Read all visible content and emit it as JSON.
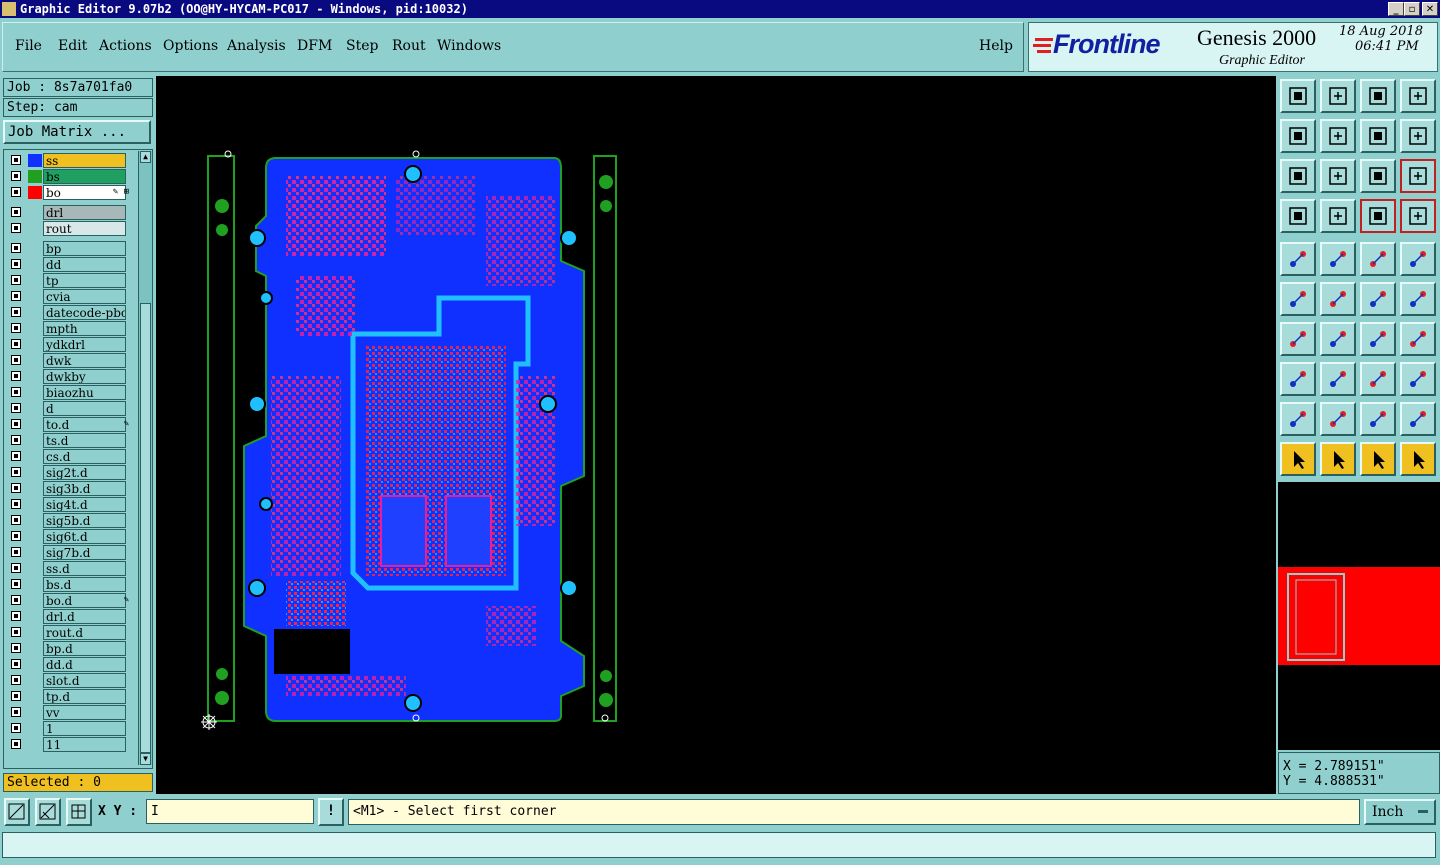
{
  "window": {
    "title": "Graphic Editor 9.07b2 (OO@HY-HYCAM-PC017 - Windows, pid:10032)"
  },
  "menu": [
    "File",
    "Edit",
    "Actions",
    "Options",
    "Analysis",
    "DFM",
    "Step",
    "Rout",
    "Windows"
  ],
  "help_label": "Help",
  "brand": {
    "logo": "Frontline",
    "product": "Genesis 2000",
    "subtitle": "Graphic Editor",
    "date": "18 Aug 2018",
    "time": "06:41 PM"
  },
  "job": {
    "job_label": "Job : 8s7a701fa0",
    "step_label": "Step: cam",
    "matrix_button": "Job Matrix ..."
  },
  "layers": [
    {
      "name": "ss",
      "bg": "#f0c020",
      "swatch": "#1030ff",
      "edit": ""
    },
    {
      "name": "bs",
      "bg": "#20a060",
      "swatch": "#20a020",
      "edit": ""
    },
    {
      "name": "bo",
      "bg": "#ffffff",
      "swatch": "#ff0000",
      "edit": "✎ ⊞",
      "active": true
    },
    {
      "name": "drl",
      "bg": "#a8b8b8",
      "swatch": "",
      "edit": "",
      "gap": true
    },
    {
      "name": "rout",
      "bg": "#d8e8e8",
      "swatch": "",
      "edit": ""
    },
    {
      "name": "bp",
      "bg": "#8fd0cf",
      "swatch": "",
      "edit": "",
      "gap": true
    },
    {
      "name": "dd",
      "bg": "#8fd0cf",
      "swatch": "",
      "edit": ""
    },
    {
      "name": "tp",
      "bg": "#8fd0cf",
      "swatch": "",
      "edit": ""
    },
    {
      "name": "cvia",
      "bg": "#8fd0cf",
      "swatch": "",
      "edit": ""
    },
    {
      "name": "datecode-pbc",
      "bg": "#8fd0cf",
      "swatch": "",
      "edit": ""
    },
    {
      "name": "mpth",
      "bg": "#8fd0cf",
      "swatch": "",
      "edit": ""
    },
    {
      "name": "ydkdrl",
      "bg": "#8fd0cf",
      "swatch": "",
      "edit": ""
    },
    {
      "name": "dwk",
      "bg": "#8fd0cf",
      "swatch": "",
      "edit": ""
    },
    {
      "name": "dwkby",
      "bg": "#8fd0cf",
      "swatch": "",
      "edit": ""
    },
    {
      "name": "biaozhu",
      "bg": "#8fd0cf",
      "swatch": "",
      "edit": ""
    },
    {
      "name": "d",
      "bg": "#8fd0cf",
      "swatch": "",
      "edit": ""
    },
    {
      "name": "to.d",
      "bg": "#8fd0cf",
      "swatch": "",
      "edit": "✎"
    },
    {
      "name": "ts.d",
      "bg": "#8fd0cf",
      "swatch": "",
      "edit": ""
    },
    {
      "name": "cs.d",
      "bg": "#8fd0cf",
      "swatch": "",
      "edit": ""
    },
    {
      "name": "sig2t.d",
      "bg": "#8fd0cf",
      "swatch": "",
      "edit": ""
    },
    {
      "name": "sig3b.d",
      "bg": "#8fd0cf",
      "swatch": "",
      "edit": ""
    },
    {
      "name": "sig4t.d",
      "bg": "#8fd0cf",
      "swatch": "",
      "edit": ""
    },
    {
      "name": "sig5b.d",
      "bg": "#8fd0cf",
      "swatch": "",
      "edit": ""
    },
    {
      "name": "sig6t.d",
      "bg": "#8fd0cf",
      "swatch": "",
      "edit": ""
    },
    {
      "name": "sig7b.d",
      "bg": "#8fd0cf",
      "swatch": "",
      "edit": ""
    },
    {
      "name": "ss.d",
      "bg": "#8fd0cf",
      "swatch": "",
      "edit": ""
    },
    {
      "name": "bs.d",
      "bg": "#8fd0cf",
      "swatch": "",
      "edit": ""
    },
    {
      "name": "bo.d",
      "bg": "#8fd0cf",
      "swatch": "",
      "edit": "✎"
    },
    {
      "name": "drl.d",
      "bg": "#8fd0cf",
      "swatch": "",
      "edit": ""
    },
    {
      "name": "rout.d",
      "bg": "#8fd0cf",
      "swatch": "",
      "edit": ""
    },
    {
      "name": "bp.d",
      "bg": "#8fd0cf",
      "swatch": "",
      "edit": ""
    },
    {
      "name": "dd.d",
      "bg": "#8fd0cf",
      "swatch": "",
      "edit": ""
    },
    {
      "name": "slot.d",
      "bg": "#8fd0cf",
      "swatch": "",
      "edit": ""
    },
    {
      "name": "tp.d",
      "bg": "#8fd0cf",
      "swatch": "",
      "edit": ""
    },
    {
      "name": "vv",
      "bg": "#8fd0cf",
      "swatch": "",
      "edit": ""
    },
    {
      "name": "1",
      "bg": "#8fd0cf",
      "swatch": "",
      "edit": ""
    },
    {
      "name": "11",
      "bg": "#8fd0cf",
      "swatch": "",
      "edit": ""
    }
  ],
  "selected_label": "Selected : 0",
  "tools": [
    "open-job-icon",
    "save-icon",
    "home-icon",
    "window-icon",
    "snap-in-icon",
    "snap-out-icon",
    "undo-icon",
    "redraw-icon",
    "zoom-fit-icon",
    "zoom-center-icon",
    "zoom-one-to-two-icon",
    "help-query-icon",
    "features-filter-icon",
    "single-layer-icon",
    "traffic-light-icon",
    "traffic-light-alt-icon",
    "feature-select-icon",
    "polygon-icon",
    "ruler-icon",
    "pad-icon",
    "net-select-icon",
    "cross-icon",
    "point-to-point-icon",
    "point-to-point-red-icon",
    "angle-icon",
    "line-icon",
    "arc-icon",
    "flip-text-icon",
    "move-node-icon",
    "line-minus-icon",
    "measure-icon",
    "copy-shapes-icon",
    "triangle-add-icon",
    "triangle-a-icon",
    "triangle-b-icon",
    "triangle-c-icon",
    "pointer-icon",
    "pointer-box-icon",
    "pointer-circle-icon",
    "route-path-icon"
  ],
  "coordinates": {
    "x": "X = 2.789151\"",
    "y": "Y = 4.888531\""
  },
  "bottom": {
    "xy_label": "X Y :",
    "prompt_icon": "!",
    "prompt": "<M1> - Select first corner",
    "units": "Inch"
  }
}
